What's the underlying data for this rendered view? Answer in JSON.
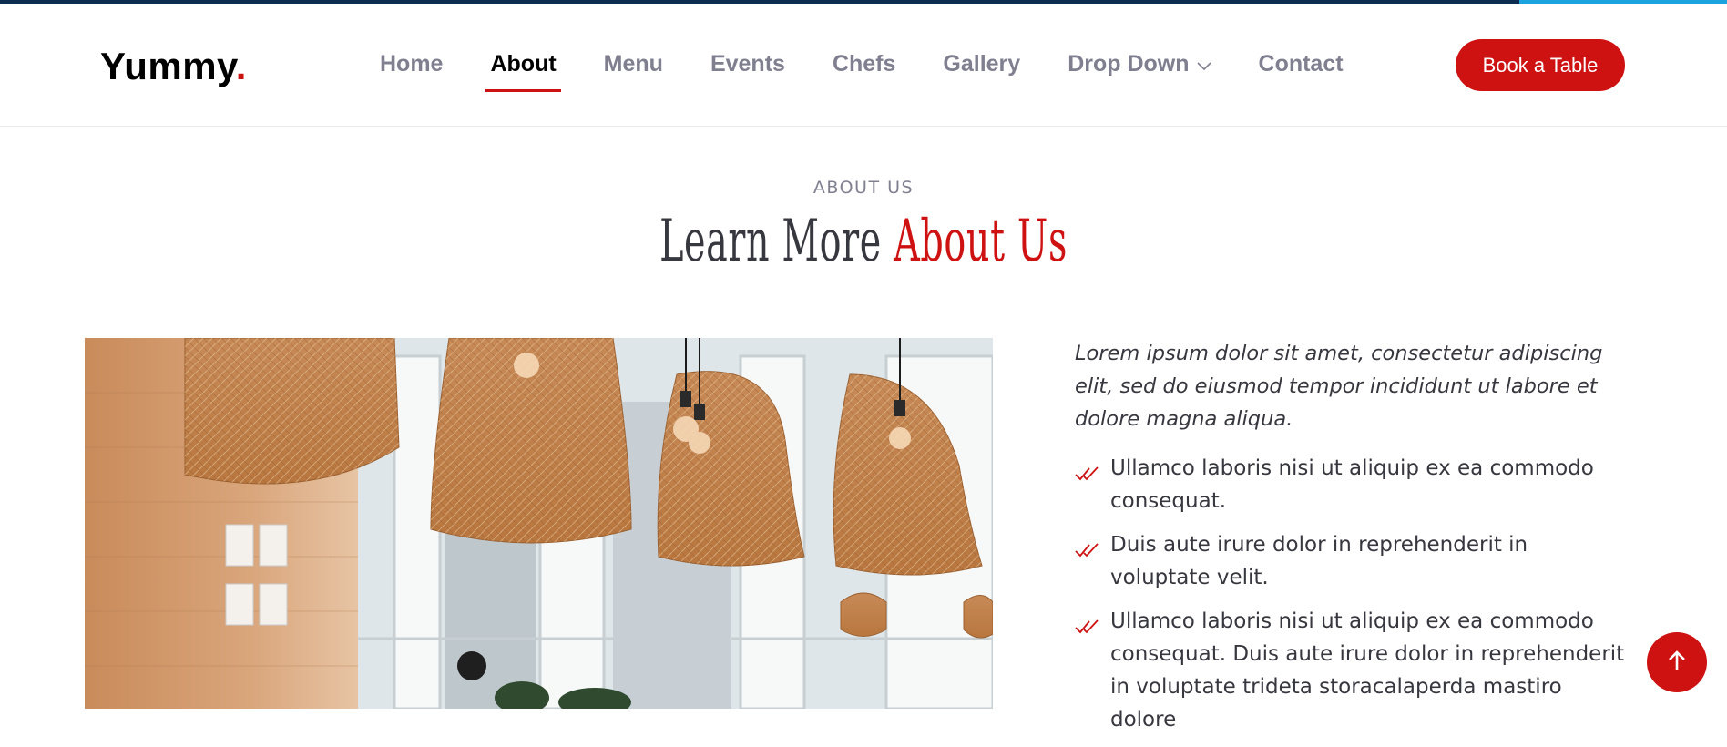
{
  "brand": {
    "name": "Yummy",
    "dot": ".",
    "accent_color": "#ce1212"
  },
  "nav": {
    "items": [
      {
        "label": "Home"
      },
      {
        "label": "About",
        "active": true
      },
      {
        "label": "Menu"
      },
      {
        "label": "Events"
      },
      {
        "label": "Chefs"
      },
      {
        "label": "Gallery"
      },
      {
        "label": "Drop Down",
        "icon": "chevron-down-icon"
      },
      {
        "label": "Contact"
      }
    ],
    "cta": "Book a Table"
  },
  "about": {
    "subtitle": "ABOUT US",
    "title_plain": "Learn More ",
    "title_accent": "About Us",
    "lead": "Lorem ipsum dolor sit amet, consectetur adipiscing elit, sed do eiusmod tempor incididunt ut labore et dolore magna aliqua.",
    "bullets": [
      "Ullamco laboris nisi ut aliquip ex ea commodo consequat.",
      "Duis aute irure dolor in reprehenderit in voluptate velit.",
      "Ullamco laboris nisi ut aliquip ex ea commodo consequat. Duis aute irure dolor in reprehenderit in voluptate trideta storacalaperda mastiro dolore"
    ],
    "bullet_icon": "double-check-icon",
    "image_subject": "restaurant interior with woven pendant lamps"
  },
  "scroll_top_icon": "arrow-up-icon"
}
